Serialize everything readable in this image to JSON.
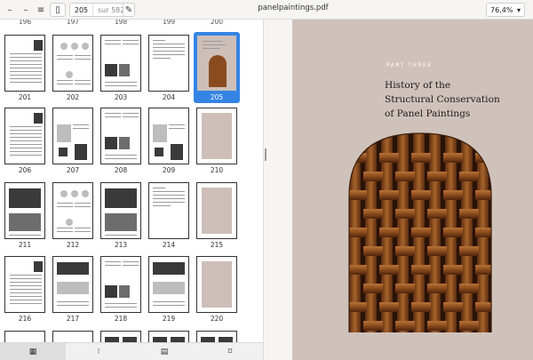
{
  "toolbar": {
    "current_page": "205",
    "of_pages": "sur 582",
    "document_title": "panelpaintings.pdf",
    "zoom": "76,4%",
    "minimize_glyph": "–",
    "menu_glyph": "≡",
    "sidebar_glyph": "▯",
    "annotate_glyph": "✎",
    "zoom_arrow_glyph": "▾"
  },
  "thumbnails": {
    "top_row": [
      "196",
      "197",
      "198",
      "199",
      "200"
    ],
    "rows": [
      [
        "201",
        "202",
        "203",
        "204",
        "205"
      ],
      [
        "206",
        "207",
        "208",
        "209",
        "210"
      ],
      [
        "211",
        "212",
        "213",
        "214",
        "215"
      ],
      [
        "216",
        "217",
        "218",
        "219",
        "220"
      ]
    ],
    "selected": "205"
  },
  "sidebar_tabs": [
    {
      "name": "thumbnails",
      "icon": "grid-icon",
      "glyph": "▦"
    },
    {
      "name": "outline",
      "icon": "outline-icon",
      "glyph": "⁝"
    },
    {
      "name": "annotations",
      "icon": "comment-icon",
      "glyph": "▤"
    },
    {
      "name": "bookmarks",
      "icon": "bookmark-icon",
      "glyph": "⌑"
    }
  ],
  "page": {
    "part_label": "PART THREE",
    "heading": [
      "History of the",
      "Structural Conservation",
      "of Panel Paintings"
    ]
  },
  "colors": {
    "page_background": "#cfc2bb",
    "selection": "#3584e4",
    "wood": "#8a4b1f"
  }
}
